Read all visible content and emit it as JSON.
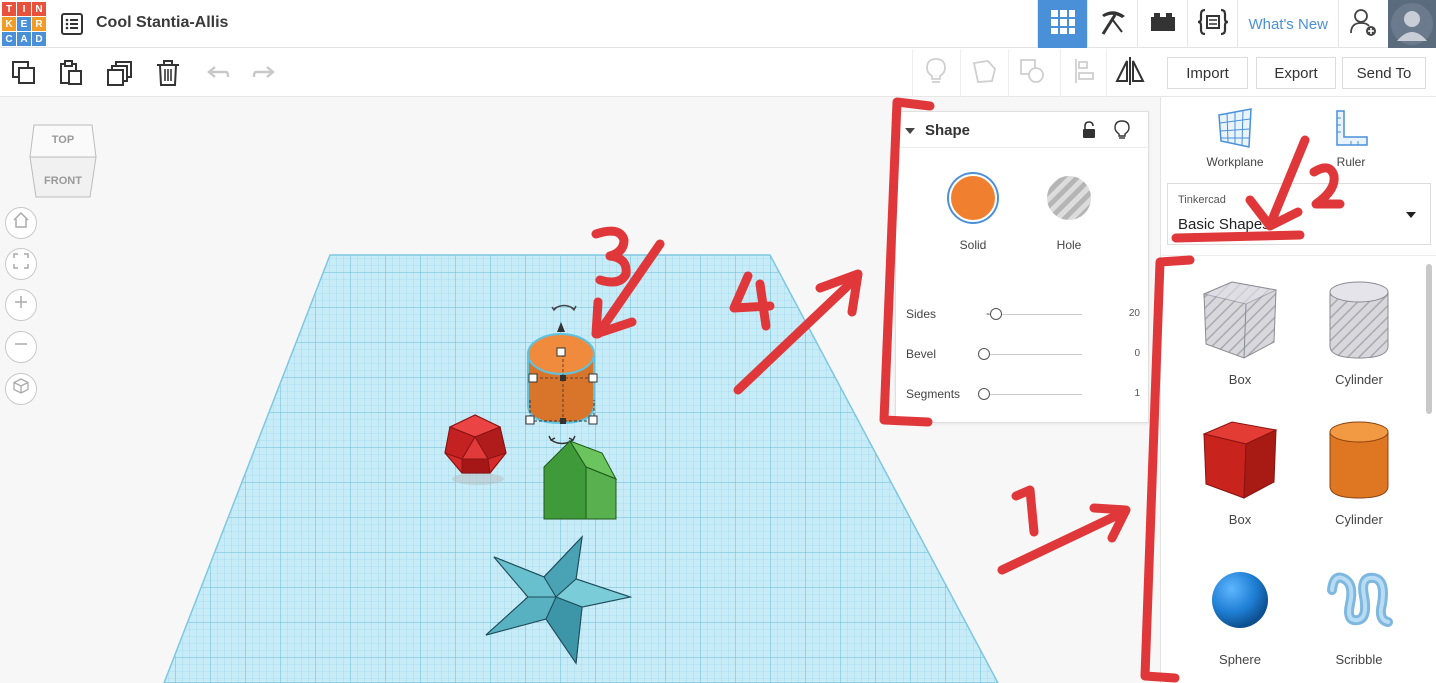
{
  "app": {
    "logo_letters": [
      "T",
      "I",
      "N",
      "K",
      "E",
      "R",
      "C",
      "A",
      "D"
    ],
    "logo_colors": [
      "#e8513b",
      "#e8513b",
      "#e8513b",
      "#f39b27",
      "#4a90d9",
      "#f39b27",
      "#4a90d9",
      "#4a90d9",
      "#4a90d9"
    ],
    "document_title": "Cool Stantia-Allis",
    "whats_new": "What's New"
  },
  "toolbar": {
    "import": "Import",
    "export": "Export",
    "send_to": "Send To"
  },
  "viewcube": {
    "top": "TOP",
    "front": "FRONT"
  },
  "inspector": {
    "title": "Shape",
    "solid": "Solid",
    "hole": "Hole",
    "solid_color": "#f08030",
    "params": [
      {
        "label": "Sides",
        "value": "20"
      },
      {
        "label": "Bevel",
        "value": "0"
      },
      {
        "label": "Segments",
        "value": "1"
      }
    ]
  },
  "right_panel": {
    "workplane": "Workplane",
    "ruler": "Ruler",
    "library_source": "Tinkercad",
    "library_name": "Basic Shapes",
    "shapes": [
      {
        "name": "Box",
        "icon": "box-hole-icon"
      },
      {
        "name": "Cylinder",
        "icon": "cylinder-hole-icon"
      },
      {
        "name": "Box",
        "icon": "box-red-icon"
      },
      {
        "name": "Cylinder",
        "icon": "cylinder-orange-icon"
      },
      {
        "name": "Sphere",
        "icon": "sphere-icon"
      },
      {
        "name": "Scribble",
        "icon": "scribble-icon"
      }
    ]
  },
  "annotations": [
    "1",
    "2",
    "3",
    "4"
  ],
  "colors": {
    "accent": "#4a90d9",
    "annotation": "#e0383a",
    "grid": "#a9dff0"
  }
}
